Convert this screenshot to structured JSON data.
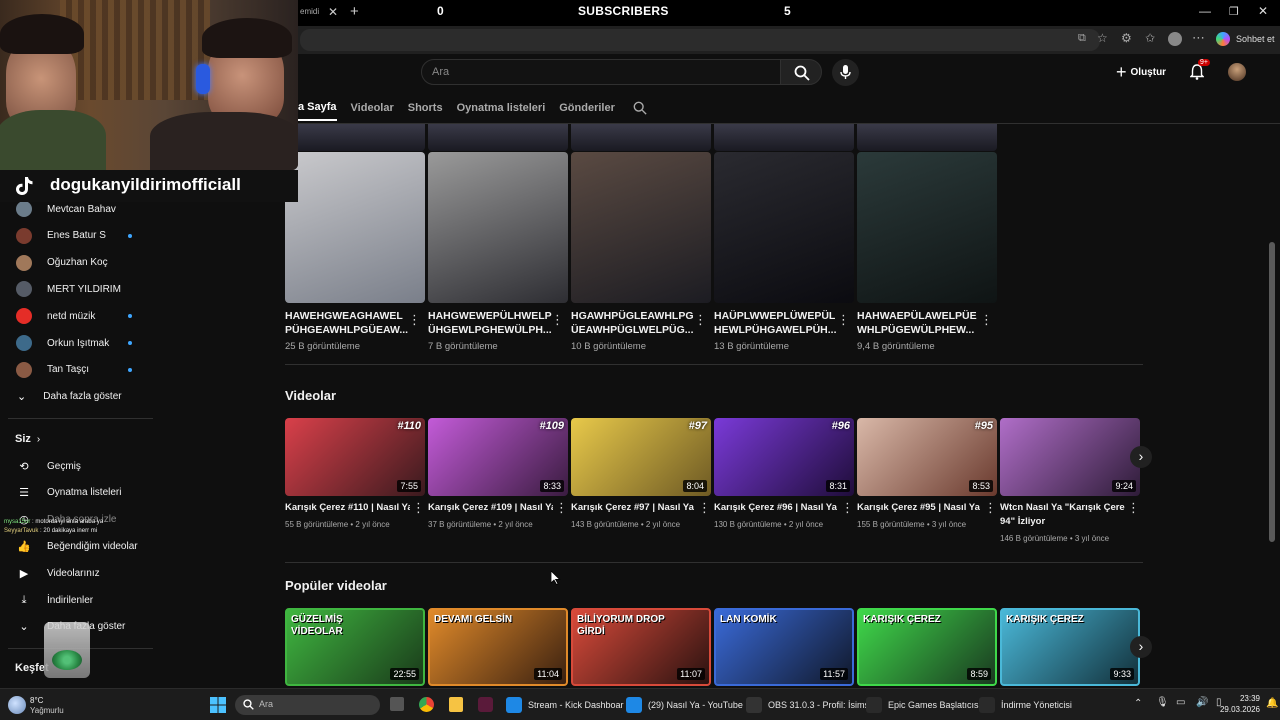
{
  "browser": {
    "tab_fragment": "emidi",
    "overlay_left_value": "0",
    "overlay_center": "SUBSCRIBERS",
    "overlay_right_value": "5",
    "copilot_label": "Sohbet et"
  },
  "header": {
    "search_placeholder": "Ara",
    "create_label": "Oluştur",
    "notif_count": "9+"
  },
  "channel_tabs": [
    {
      "label": "a Sayfa",
      "active": true
    },
    {
      "label": "Videolar",
      "active": false
    },
    {
      "label": "Shorts",
      "active": false
    },
    {
      "label": "Oynatma listeleri",
      "active": false
    },
    {
      "label": "Gönderiler",
      "active": false
    }
  ],
  "tiktok_handle": "dogukanyildirimofficiall",
  "sidebar": {
    "subs": [
      {
        "name": "Mevtcan Bahav",
        "color": "#6b7c8a",
        "dot": false
      },
      {
        "name": "Enes Batur S",
        "color": "#7a3b2e",
        "dot": true
      },
      {
        "name": "Oğuzhan Koç",
        "color": "#a0785a",
        "dot": false
      },
      {
        "name": "MERT YILDIRIM",
        "color": "#555b66",
        "dot": false
      },
      {
        "name": "netd müzik",
        "color": "#e52d27",
        "dot": true
      },
      {
        "name": "Orkun Işıtmak",
        "color": "#3d6a8a",
        "dot": true
      },
      {
        "name": "Tan Taşçı",
        "color": "#8a5a44",
        "dot": true
      }
    ],
    "show_more": "Daha fazla göster",
    "you_heading": "Siz",
    "you_items": [
      {
        "label": "Geçmiş",
        "icon": "history-icon"
      },
      {
        "label": "Oynatma listeleri",
        "icon": "playlist-icon"
      },
      {
        "label": "Daha sonra izle",
        "icon": "clock-icon"
      },
      {
        "label": "Beğendiğim videolar",
        "icon": "like-icon"
      },
      {
        "label": "Videolarınız",
        "icon": "video-icon"
      },
      {
        "label": "İndirilenler",
        "icon": "download-icon"
      },
      {
        "label": "Daha fazla göster",
        "icon": "chevron-down-icon"
      }
    ],
    "explore_heading": "Keşfet"
  },
  "chat": [
    {
      "user": "mysa15ur",
      "text": "motorda iyi anta araba ya"
    },
    {
      "user": "SeyyarTavuk",
      "text": "20 dakikaya inerr mi"
    }
  ],
  "shorts": [
    {
      "title1": "HAWEHGWEAGHAWEL",
      "title2": "PÜHGEAWHLPGÜEAW...",
      "views": "25 B görüntüleme",
      "c1": "#c9c9cc",
      "c2": "#7a7f8a"
    },
    {
      "title1": "HAHGWEWEPÜLHWELP",
      "title2": "ÜHGEWLPGHEWÜLPH...",
      "views": "7 B görüntüleme",
      "c1": "#9a9a9a",
      "c2": "#2e2e33"
    },
    {
      "title1": "HGAWHPÜGLEAWHLPG",
      "title2": "ÜEAWHPÜGLWELPÜG...",
      "views": "10 B görüntüleme",
      "c1": "#5a4a42",
      "c2": "#1c1c22"
    },
    {
      "title1": "HAÜPLWWEPLÜWEPÜL",
      "title2": "HEWLPÜHGAWELPÜH...",
      "views": "13 B görüntüleme",
      "c1": "#2a2a30",
      "c2": "#0b0b10"
    },
    {
      "title1": "HAHWAEPÜLAWELPÜE",
      "title2": "WHLPÜGEWÜLPHEW...",
      "views": "9,4 B görüntüleme",
      "c1": "#2b3a3a",
      "c2": "#0f1414"
    }
  ],
  "videos_heading": "Videolar",
  "videos": [
    {
      "title1": "Karışık Çerez #110 | Nasıl Ya",
      "title2": "",
      "meta": "55 B görüntüleme • 2 yıl önce",
      "dur": "7:55",
      "badge": "#110",
      "c1": "#d9404a",
      "c2": "#3a1a1e"
    },
    {
      "title1": "Karışık Çerez #109 | Nasıl Ya",
      "title2": "",
      "meta": "37 B görüntüleme • 2 yıl önce",
      "dur": "8:33",
      "badge": "#109",
      "c1": "#c35bd8",
      "c2": "#3a1c40"
    },
    {
      "title1": "Karışık Çerez #97 | Nasıl Ya",
      "title2": "",
      "meta": "143 B görüntüleme • 2 yıl önce",
      "dur": "8:04",
      "badge": "#97",
      "c1": "#e8c94a",
      "c2": "#6e5a24"
    },
    {
      "title1": "Karışık Çerez #96 | Nasıl Ya",
      "title2": "",
      "meta": "130 B görüntüleme • 2 yıl önce",
      "dur": "8:31",
      "badge": "#96",
      "c1": "#7a3ad8",
      "c2": "#1f0d3a"
    },
    {
      "title1": "Karışık Çerez #95 | Nasıl Ya",
      "title2": "",
      "meta": "155 B görüntüleme • 3 yıl önce",
      "dur": "8:53",
      "badge": "#95",
      "c1": "#d9b8a8",
      "c2": "#6a3a2e"
    },
    {
      "title1": "Wtcn Nasıl Ya \"Karışık Çerez",
      "title2": "94\" İzliyor",
      "meta": "146 B görüntüleme • 3 yıl önce",
      "dur": "9:24",
      "badge": "",
      "c1": "#b06ec8",
      "c2": "#2e1c38"
    }
  ],
  "popular_heading": "Popüler videolar",
  "popular": [
    {
      "dur": "22:55",
      "caption": "GÜZELMİŞ VİDEOLAR",
      "c1": "#3fb640",
      "c2": "#1a3a1a"
    },
    {
      "dur": "11:04",
      "caption": "DEVAMI GELSİN",
      "c1": "#e08a2a",
      "c2": "#3a2010"
    },
    {
      "dur": "11:07",
      "caption": "BİLİYORUM DROP GİRDİ",
      "c1": "#d84a3a",
      "c2": "#2a1210"
    },
    {
      "dur": "11:57",
      "caption": "LAN KOMİK",
      "c1": "#3a6ad8",
      "c2": "#10182a"
    },
    {
      "dur": "8:59",
      "caption": "KARIŞIK ÇEREZ",
      "c1": "#3fd84a",
      "c2": "#1a3a20"
    },
    {
      "dur": "9:33",
      "caption": "KARIŞIK ÇEREZ",
      "c1": "#4ab8d8",
      "c2": "#12303a"
    }
  ],
  "taskbar": {
    "weather_temp": "8°C",
    "weather_text": "Yağmurlu",
    "search_placeholder": "Ara",
    "apps": [
      {
        "label": "Stream - Kick Dashboar",
        "color": "#1e88e5"
      },
      {
        "label": "(29) Nasıl Ya - YouTube",
        "color": "#1e88e5"
      },
      {
        "label": "OBS 31.0.3 - Profil: İsims",
        "color": "#333"
      },
      {
        "label": "Epic Games Başlatıcısı",
        "color": "#2a2a2a"
      },
      {
        "label": "İndirme Yöneticisi",
        "color": "#2a2a2a"
      }
    ],
    "time": "23:39",
    "date": "29.03.2026"
  }
}
